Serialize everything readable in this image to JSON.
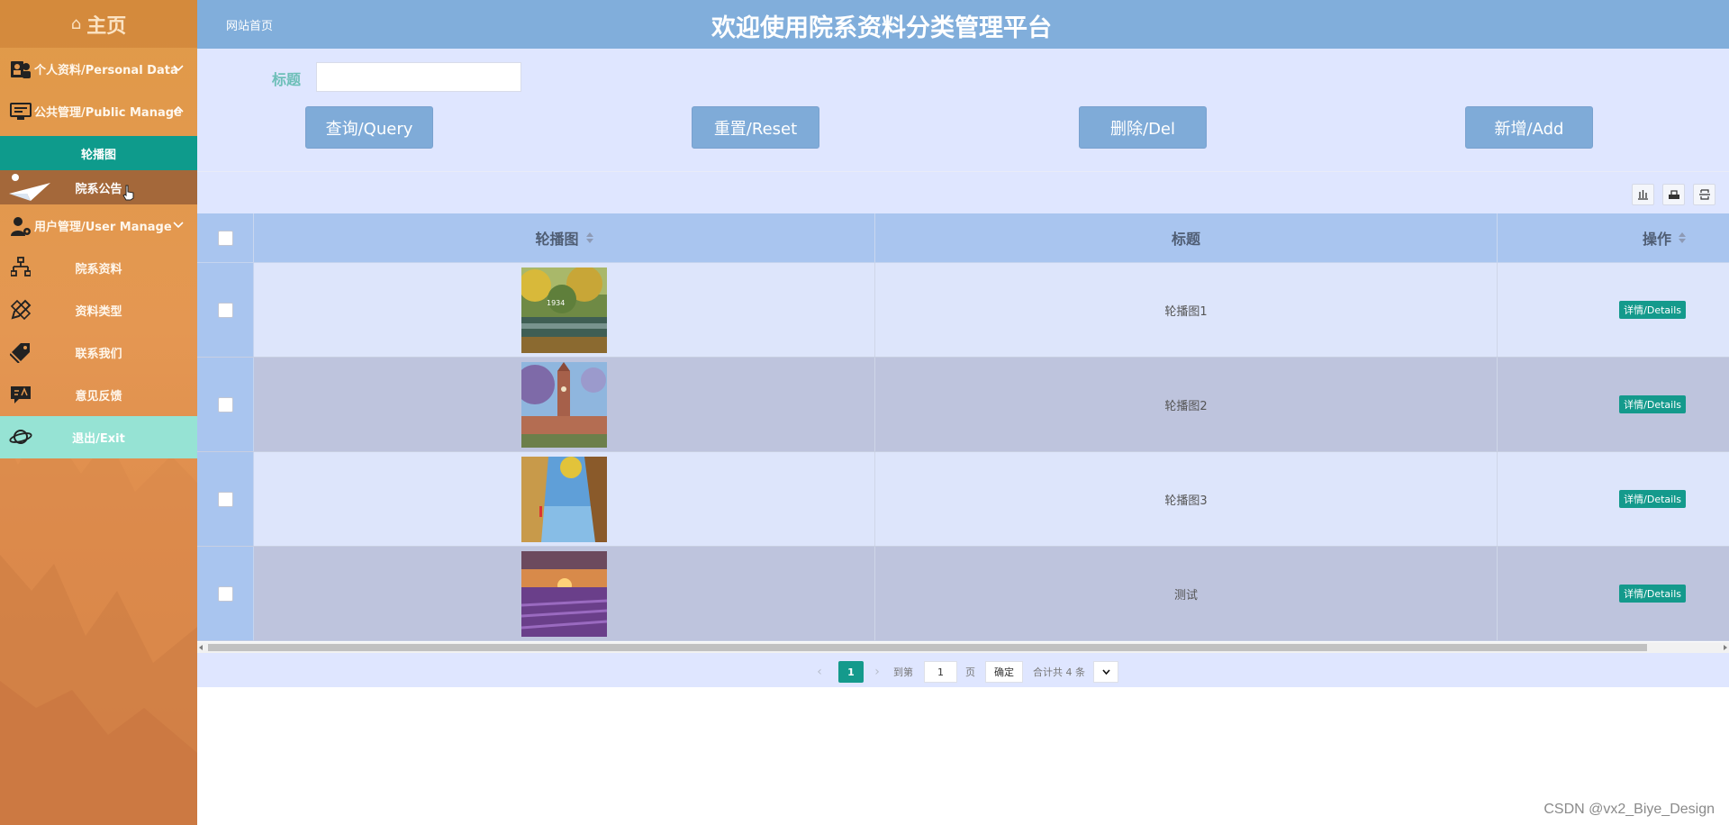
{
  "sidebar": {
    "home": "主页",
    "personal": "个人资料/Personal Data",
    "public": "公共管理/Public Manage",
    "sub_carousel": "轮播图",
    "sub_notice": "院系公告",
    "user_manage": "用户管理/User Manage",
    "dept_data": "院系资料",
    "data_type": "资料类型",
    "contact": "联系我们",
    "feedback": "意见反馈",
    "exit": "退出/Exit"
  },
  "header": {
    "breadcrumb": "网站首页",
    "title": "欢迎使用院系资料分类管理平台"
  },
  "search": {
    "label": "标题",
    "value": "",
    "query": "查询/Query",
    "reset": "重置/Reset",
    "delete": "删除/Del",
    "add": "新增/Add"
  },
  "table": {
    "columns": [
      "轮播图",
      "标题",
      "操作"
    ],
    "rows": [
      {
        "title": "轮播图1",
        "action": "详情/Details",
        "image": "autumn-campus-lake"
      },
      {
        "title": "轮播图2",
        "action": "详情/Details",
        "image": "clock-tower"
      },
      {
        "title": "轮播图3",
        "action": "详情/Details",
        "image": "sky-building"
      },
      {
        "title": "测试",
        "action": "详情/Details",
        "image": "lavender-sunset"
      }
    ]
  },
  "pagination": {
    "current": "1",
    "goto_prefix": "到第",
    "goto_value": "1",
    "goto_suffix": "页",
    "confirm": "确定",
    "total": "合计共 4 条"
  },
  "watermark": "CSDN @vx2_Biye_Design"
}
